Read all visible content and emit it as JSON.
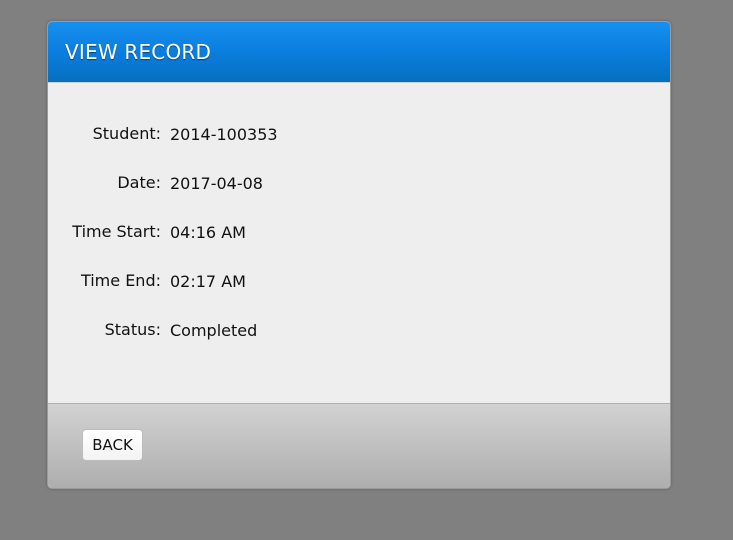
{
  "dialog": {
    "title": "VIEW RECORD",
    "header_color": "#0a7ede"
  },
  "record": {
    "fields": [
      {
        "label": "Student:",
        "value": "2014-100353"
      },
      {
        "label": "Date:",
        "value": "2017-04-08"
      },
      {
        "label": "Time Start:",
        "value": "04:16 AM"
      },
      {
        "label": "Time End:",
        "value": "02:17 AM"
      },
      {
        "label": "Status:",
        "value": "Completed"
      }
    ]
  },
  "footer": {
    "back_label": "BACK"
  }
}
